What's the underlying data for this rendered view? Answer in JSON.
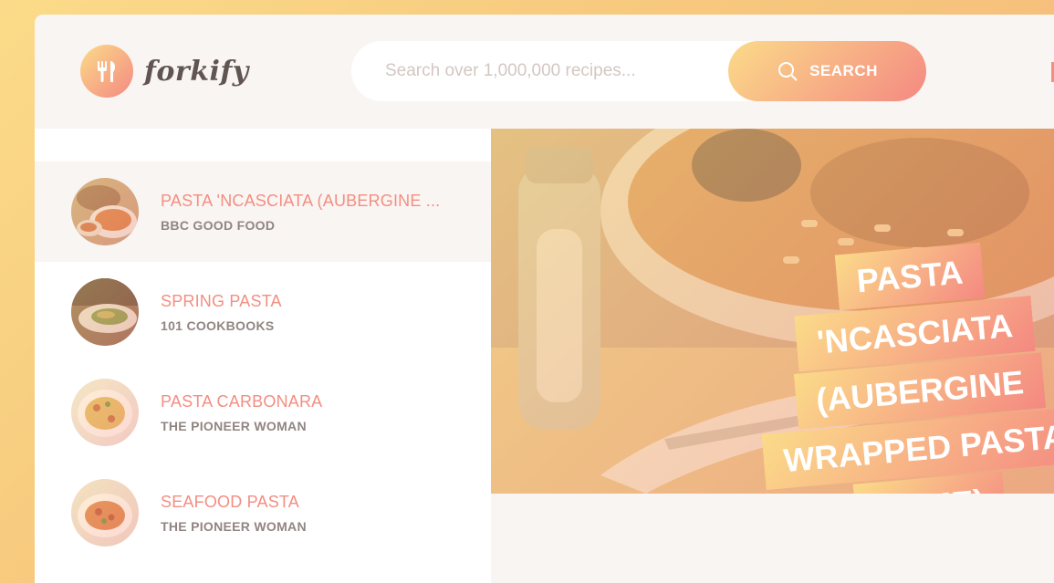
{
  "app": {
    "name": "forkify"
  },
  "search": {
    "placeholder": "Search over 1,000,000 recipes...",
    "button_label": "SEARCH"
  },
  "results": [
    {
      "title": "PASTA 'NCASCIATA (AUBERGINE ...",
      "publisher": "BBC GOOD FOOD",
      "active": true
    },
    {
      "title": "SPRING PASTA",
      "publisher": "101 COOKBOOKS",
      "active": false
    },
    {
      "title": "PASTA CARBONARA",
      "publisher": "THE PIONEER WOMAN",
      "active": false
    },
    {
      "title": "SEAFOOD PASTA",
      "publisher": "THE PIONEER WOMAN",
      "active": false
    }
  ],
  "recipe": {
    "title": "PASTA 'NCASCIATA (AUBERGINE WRAPPED PASTA DOME)"
  },
  "colors": {
    "accent": "#f38e82",
    "gradient_start": "#fbdb89",
    "gradient_end": "#f48982",
    "publisher_text": "#918581",
    "background": "#f9f5f3"
  }
}
